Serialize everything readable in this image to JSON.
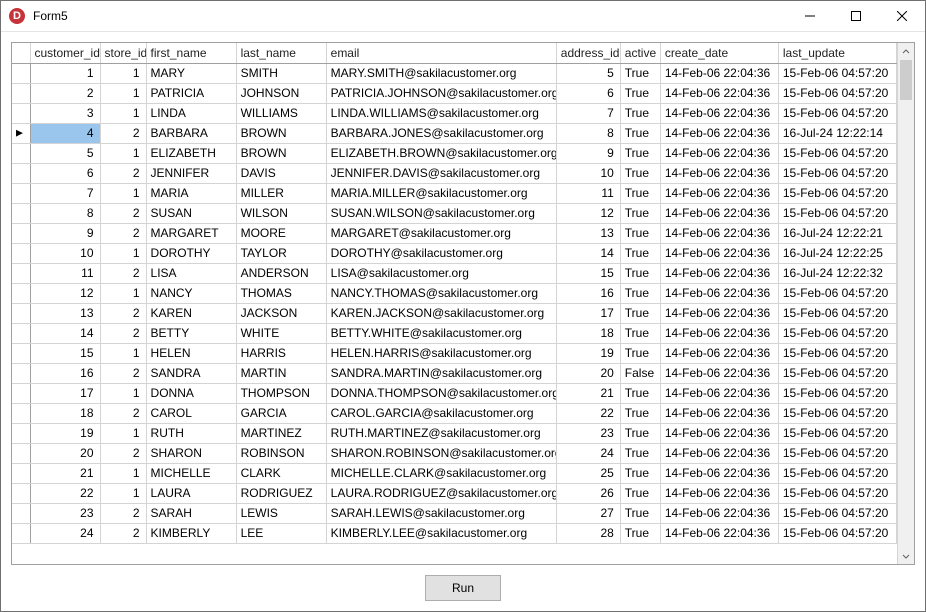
{
  "window": {
    "title": "Form5",
    "icon_letter": "D"
  },
  "columns": [
    {
      "key": "customer_id",
      "label": "customer_id",
      "align": "num"
    },
    {
      "key": "store_id",
      "label": "store_id",
      "align": "num"
    },
    {
      "key": "first_name",
      "label": "first_name",
      "align": "text"
    },
    {
      "key": "last_name",
      "label": "last_name",
      "align": "text"
    },
    {
      "key": "email",
      "label": "email",
      "align": "text"
    },
    {
      "key": "address_id",
      "label": "address_id",
      "align": "num"
    },
    {
      "key": "active",
      "label": "active",
      "align": "text"
    },
    {
      "key": "create_date",
      "label": "create_date",
      "align": "text"
    },
    {
      "key": "last_update",
      "label": "last_update",
      "align": "text"
    }
  ],
  "rows": [
    {
      "customer_id": 1,
      "store_id": 1,
      "first_name": "MARY",
      "last_name": "SMITH",
      "email": "MARY.SMITH@sakilacustomer.org",
      "address_id": 5,
      "active": "True",
      "create_date": "14-Feb-06 22:04:36",
      "last_update": "15-Feb-06 04:57:20"
    },
    {
      "customer_id": 2,
      "store_id": 1,
      "first_name": "PATRICIA",
      "last_name": "JOHNSON",
      "email": "PATRICIA.JOHNSON@sakilacustomer.org",
      "address_id": 6,
      "active": "True",
      "create_date": "14-Feb-06 22:04:36",
      "last_update": "15-Feb-06 04:57:20"
    },
    {
      "customer_id": 3,
      "store_id": 1,
      "first_name": "LINDA",
      "last_name": "WILLIAMS",
      "email": "LINDA.WILLIAMS@sakilacustomer.org",
      "address_id": 7,
      "active": "True",
      "create_date": "14-Feb-06 22:04:36",
      "last_update": "15-Feb-06 04:57:20"
    },
    {
      "customer_id": 4,
      "store_id": 2,
      "first_name": "BARBARA",
      "last_name": "BROWN",
      "email": "BARBARA.JONES@sakilacustomer.org",
      "address_id": 8,
      "active": "True",
      "create_date": "14-Feb-06 22:04:36",
      "last_update": "16-Jul-24 12:22:14"
    },
    {
      "customer_id": 5,
      "store_id": 1,
      "first_name": "ELIZABETH",
      "last_name": "BROWN",
      "email": "ELIZABETH.BROWN@sakilacustomer.org",
      "address_id": 9,
      "active": "True",
      "create_date": "14-Feb-06 22:04:36",
      "last_update": "15-Feb-06 04:57:20"
    },
    {
      "customer_id": 6,
      "store_id": 2,
      "first_name": "JENNIFER",
      "last_name": "DAVIS",
      "email": "JENNIFER.DAVIS@sakilacustomer.org",
      "address_id": 10,
      "active": "True",
      "create_date": "14-Feb-06 22:04:36",
      "last_update": "15-Feb-06 04:57:20"
    },
    {
      "customer_id": 7,
      "store_id": 1,
      "first_name": "MARIA",
      "last_name": "MILLER",
      "email": "MARIA.MILLER@sakilacustomer.org",
      "address_id": 11,
      "active": "True",
      "create_date": "14-Feb-06 22:04:36",
      "last_update": "15-Feb-06 04:57:20"
    },
    {
      "customer_id": 8,
      "store_id": 2,
      "first_name": "SUSAN",
      "last_name": "WILSON",
      "email": "SUSAN.WILSON@sakilacustomer.org",
      "address_id": 12,
      "active": "True",
      "create_date": "14-Feb-06 22:04:36",
      "last_update": "15-Feb-06 04:57:20"
    },
    {
      "customer_id": 9,
      "store_id": 2,
      "first_name": "MARGARET",
      "last_name": "MOORE",
      "email": "MARGARET@sakilacustomer.org",
      "address_id": 13,
      "active": "True",
      "create_date": "14-Feb-06 22:04:36",
      "last_update": "16-Jul-24 12:22:21"
    },
    {
      "customer_id": 10,
      "store_id": 1,
      "first_name": "DOROTHY",
      "last_name": "TAYLOR",
      "email": "DOROTHY@sakilacustomer.org",
      "address_id": 14,
      "active": "True",
      "create_date": "14-Feb-06 22:04:36",
      "last_update": "16-Jul-24 12:22:25"
    },
    {
      "customer_id": 11,
      "store_id": 2,
      "first_name": "LISA",
      "last_name": "ANDERSON",
      "email": "LISA@sakilacustomer.org",
      "address_id": 15,
      "active": "True",
      "create_date": "14-Feb-06 22:04:36",
      "last_update": "16-Jul-24 12:22:32"
    },
    {
      "customer_id": 12,
      "store_id": 1,
      "first_name": "NANCY",
      "last_name": "THOMAS",
      "email": "NANCY.THOMAS@sakilacustomer.org",
      "address_id": 16,
      "active": "True",
      "create_date": "14-Feb-06 22:04:36",
      "last_update": "15-Feb-06 04:57:20"
    },
    {
      "customer_id": 13,
      "store_id": 2,
      "first_name": "KAREN",
      "last_name": "JACKSON",
      "email": "KAREN.JACKSON@sakilacustomer.org",
      "address_id": 17,
      "active": "True",
      "create_date": "14-Feb-06 22:04:36",
      "last_update": "15-Feb-06 04:57:20"
    },
    {
      "customer_id": 14,
      "store_id": 2,
      "first_name": "BETTY",
      "last_name": "WHITE",
      "email": "BETTY.WHITE@sakilacustomer.org",
      "address_id": 18,
      "active": "True",
      "create_date": "14-Feb-06 22:04:36",
      "last_update": "15-Feb-06 04:57:20"
    },
    {
      "customer_id": 15,
      "store_id": 1,
      "first_name": "HELEN",
      "last_name": "HARRIS",
      "email": "HELEN.HARRIS@sakilacustomer.org",
      "address_id": 19,
      "active": "True",
      "create_date": "14-Feb-06 22:04:36",
      "last_update": "15-Feb-06 04:57:20"
    },
    {
      "customer_id": 16,
      "store_id": 2,
      "first_name": "SANDRA",
      "last_name": "MARTIN",
      "email": "SANDRA.MARTIN@sakilacustomer.org",
      "address_id": 20,
      "active": "False",
      "create_date": "14-Feb-06 22:04:36",
      "last_update": "15-Feb-06 04:57:20"
    },
    {
      "customer_id": 17,
      "store_id": 1,
      "first_name": "DONNA",
      "last_name": "THOMPSON",
      "email": "DONNA.THOMPSON@sakilacustomer.org",
      "address_id": 21,
      "active": "True",
      "create_date": "14-Feb-06 22:04:36",
      "last_update": "15-Feb-06 04:57:20"
    },
    {
      "customer_id": 18,
      "store_id": 2,
      "first_name": "CAROL",
      "last_name": "GARCIA",
      "email": "CAROL.GARCIA@sakilacustomer.org",
      "address_id": 22,
      "active": "True",
      "create_date": "14-Feb-06 22:04:36",
      "last_update": "15-Feb-06 04:57:20"
    },
    {
      "customer_id": 19,
      "store_id": 1,
      "first_name": "RUTH",
      "last_name": "MARTINEZ",
      "email": "RUTH.MARTINEZ@sakilacustomer.org",
      "address_id": 23,
      "active": "True",
      "create_date": "14-Feb-06 22:04:36",
      "last_update": "15-Feb-06 04:57:20"
    },
    {
      "customer_id": 20,
      "store_id": 2,
      "first_name": "SHARON",
      "last_name": "ROBINSON",
      "email": "SHARON.ROBINSON@sakilacustomer.org",
      "address_id": 24,
      "active": "True",
      "create_date": "14-Feb-06 22:04:36",
      "last_update": "15-Feb-06 04:57:20"
    },
    {
      "customer_id": 21,
      "store_id": 1,
      "first_name": "MICHELLE",
      "last_name": "CLARK",
      "email": "MICHELLE.CLARK@sakilacustomer.org",
      "address_id": 25,
      "active": "True",
      "create_date": "14-Feb-06 22:04:36",
      "last_update": "15-Feb-06 04:57:20"
    },
    {
      "customer_id": 22,
      "store_id": 1,
      "first_name": "LAURA",
      "last_name": "RODRIGUEZ",
      "email": "LAURA.RODRIGUEZ@sakilacustomer.org",
      "address_id": 26,
      "active": "True",
      "create_date": "14-Feb-06 22:04:36",
      "last_update": "15-Feb-06 04:57:20"
    },
    {
      "customer_id": 23,
      "store_id": 2,
      "first_name": "SARAH",
      "last_name": "LEWIS",
      "email": "SARAH.LEWIS@sakilacustomer.org",
      "address_id": 27,
      "active": "True",
      "create_date": "14-Feb-06 22:04:36",
      "last_update": "15-Feb-06 04:57:20"
    },
    {
      "customer_id": 24,
      "store_id": 2,
      "first_name": "KIMBERLY",
      "last_name": "LEE",
      "email": "KIMBERLY.LEE@sakilacustomer.org",
      "address_id": 28,
      "active": "True",
      "create_date": "14-Feb-06 22:04:36",
      "last_update": "15-Feb-06 04:57:20"
    }
  ],
  "selection": {
    "row_index": 3,
    "column_key": "customer_id"
  },
  "buttons": {
    "run_label": "Run"
  }
}
